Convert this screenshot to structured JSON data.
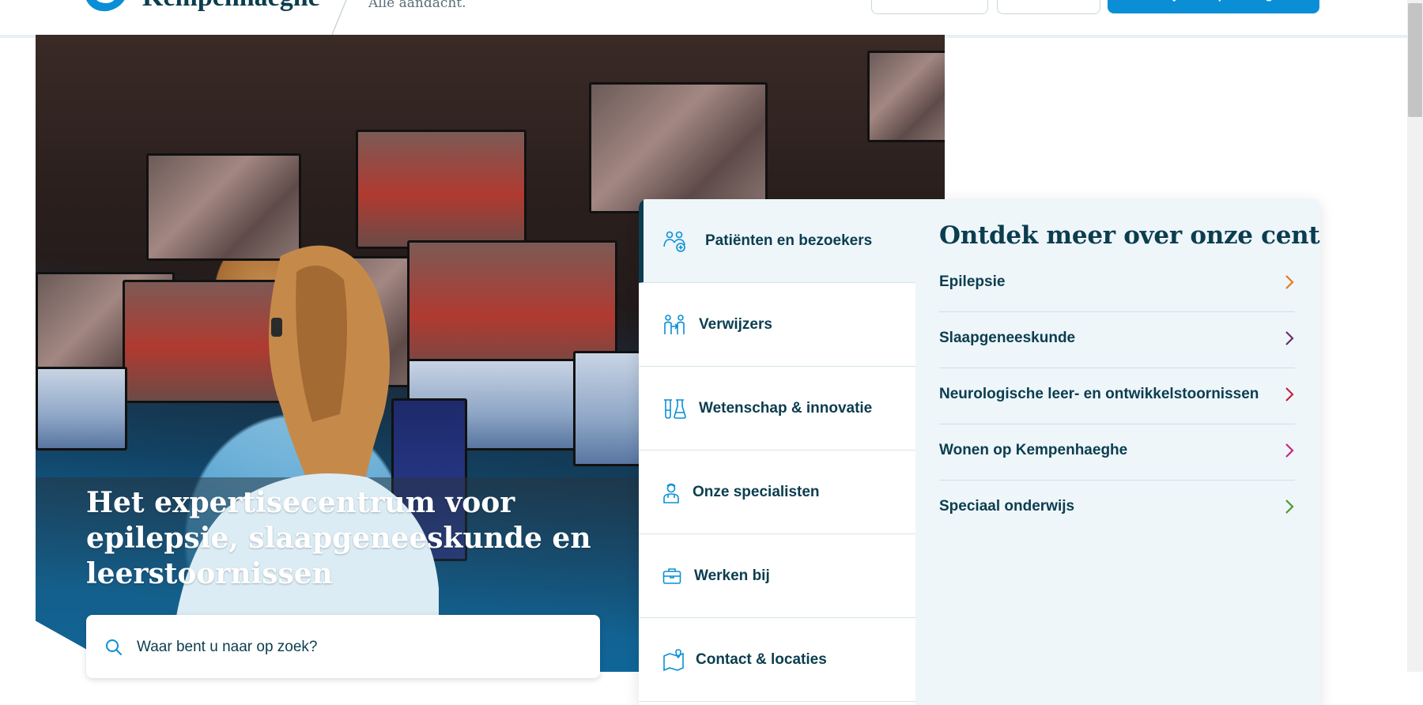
{
  "header": {
    "logo_text": "Kempenhaeghe",
    "tagline": "Alle aandacht.",
    "cta_label": "Mijn Kempenhaeghe"
  },
  "hero": {
    "title": "Het expertisecentrum voor epilepsie, slaapgeneeskunde en leerstoornissen",
    "search_placeholder": "Waar bent u naar op zoek?"
  },
  "panel": {
    "nav_items": [
      {
        "label": "Patiënten en bezoekers",
        "icon": "patients-icon",
        "active": true
      },
      {
        "label": "Verwijzers",
        "icon": "referrers-icon",
        "active": false
      },
      {
        "label": "Wetenschap & innovatie",
        "icon": "lab-flask-icon",
        "active": false
      },
      {
        "label": "Onze specialisten",
        "icon": "doctor-icon",
        "active": false
      },
      {
        "label": "Werken bij",
        "icon": "briefcase-icon",
        "active": false
      },
      {
        "label": "Contact & locaties",
        "icon": "map-pin-icon",
        "active": false
      }
    ],
    "section_title": "Ontdek meer over onze centra",
    "centers": [
      {
        "label": "Epilepsie",
        "color": "#e07a1f"
      },
      {
        "label": "Slaapgeneeskunde",
        "color": "#6b2e6e"
      },
      {
        "label": "Neurologische leer- en ontwikkelstoornissen",
        "color": "#c0263a"
      },
      {
        "label": "Wonen op Kempenhaeghe",
        "color": "#c8287a"
      },
      {
        "label": "Speciaal onderwijs",
        "color": "#4c9a2a"
      }
    ]
  },
  "colors": {
    "primary_dark": "#0b3d4f",
    "accent_blue": "#0a8fd6",
    "panel_tint": "#eef6fa"
  }
}
